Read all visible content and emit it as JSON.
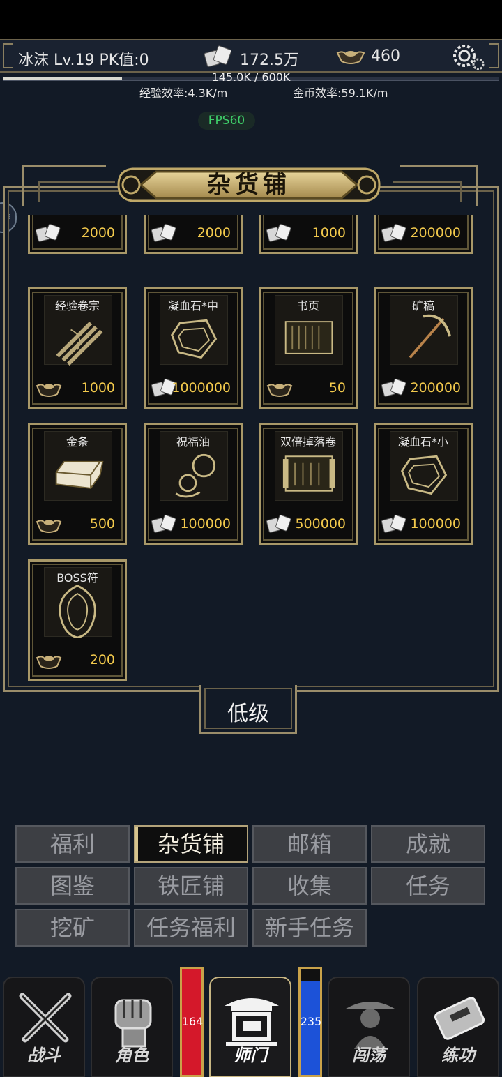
{
  "hud": {
    "player": "冰沫 Lv.19 PK值:0",
    "coins": "172.5万",
    "ingots": "460",
    "exp_text": "145.0K / 600K",
    "exp_fraction": 0.24,
    "exp_rate": "经验效率:4.3K/m",
    "gold_rate": "金币效率:59.1K/m",
    "fps": "FPS60",
    "side_tab": "22"
  },
  "shop": {
    "title": "杂货铺",
    "grade": "低级",
    "items": [
      {
        "name": "",
        "price": "2000",
        "currency": "coin-icon"
      },
      {
        "name": "",
        "price": "2000",
        "currency": "coin-icon"
      },
      {
        "name": "",
        "price": "1000",
        "currency": "coin-icon"
      },
      {
        "name": "",
        "price": "200000",
        "currency": "coin-icon"
      },
      {
        "name": "经验卷宗",
        "price": "1000",
        "currency": "ingot-icon",
        "icon": "scroll-bundle-icon"
      },
      {
        "name": "凝血石*中",
        "price": "1000000",
        "currency": "coin-icon",
        "icon": "gem-icon"
      },
      {
        "name": "书页",
        "price": "50",
        "currency": "ingot-icon",
        "icon": "book-page-icon"
      },
      {
        "name": "矿稿",
        "price": "200000",
        "currency": "coin-icon",
        "icon": "pickaxe-icon"
      },
      {
        "name": "金条",
        "price": "500",
        "currency": "ingot-icon",
        "icon": "gold-bar-icon"
      },
      {
        "name": "祝福油",
        "price": "100000",
        "currency": "coin-icon",
        "icon": "gourd-icon"
      },
      {
        "name": "双倍掉落卷",
        "price": "500000",
        "currency": "coin-icon",
        "icon": "scroll-icon"
      },
      {
        "name": "凝血石*小",
        "price": "100000",
        "currency": "coin-icon",
        "icon": "gem-icon"
      },
      {
        "name": "BOSS符",
        "price": "200",
        "currency": "ingot-icon",
        "icon": "talisman-icon"
      }
    ]
  },
  "menu": {
    "items": [
      "福利",
      "杂货铺",
      "邮箱",
      "成就",
      "图鉴",
      "铁匠铺",
      "收集",
      "任务",
      "挖矿",
      "任务福利",
      "新手任务"
    ],
    "active": "杂货铺"
  },
  "nav": {
    "items": [
      "战斗",
      "角色",
      "师门",
      "闯荡",
      "练功"
    ],
    "active": "师门",
    "hp": "164",
    "mp": "235"
  },
  "colors": {
    "gold_frame": "#9a8d6a",
    "price": "#f2c94c",
    "fps": "#3fd06a",
    "hp": "#d4182a",
    "mp": "#1c52d8"
  }
}
